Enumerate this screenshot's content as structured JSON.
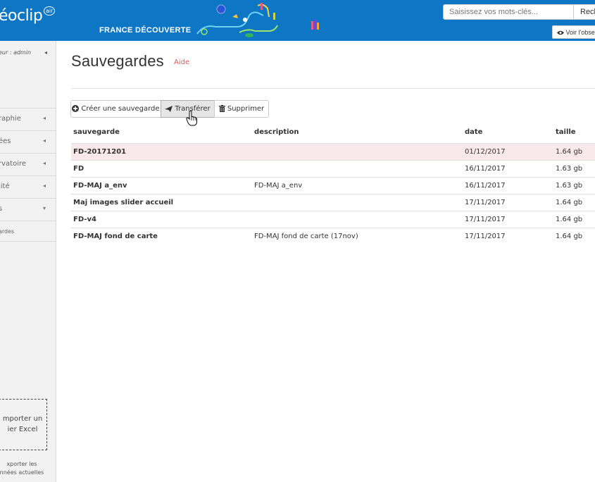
{
  "header": {
    "logo": "éoclip",
    "logo_sup": "air",
    "subtitle": "FRANCE DÉCOUVERTE",
    "search_placeholder": "Saisissez vos mots-clés...",
    "search_button": "Rech",
    "observer_button": "Voir l'obse"
  },
  "sidebar": {
    "user": "eur : admin",
    "items": [
      {
        "label": "raphie",
        "arrow": "◂"
      },
      {
        "label": "ées",
        "arrow": "◂"
      },
      {
        "label": "rvatoire",
        "arrow": "◂"
      },
      {
        "label": "lité",
        "arrow": "◂"
      },
      {
        "label": "s",
        "arrow": "▾"
      }
    ],
    "sub_item": "ardes",
    "import_label": "mporter un\nier Excel",
    "export_label": "xporter les\nnnées actuelles"
  },
  "main": {
    "title": "Sauvegardes",
    "help": "Aide",
    "buttons": {
      "create": "Créer une sauvegarde",
      "transfer": "Transférer",
      "delete": "Supprimer"
    },
    "columns": [
      "sauvegarde",
      "description",
      "date",
      "taille"
    ],
    "rows": [
      {
        "name": "FD-20171201",
        "description": "",
        "date": "01/12/2017",
        "size": "1.64 gb",
        "selected": true
      },
      {
        "name": "FD",
        "description": "",
        "date": "16/11/2017",
        "size": "1.63 gb",
        "selected": false
      },
      {
        "name": "FD-MAJ a_env",
        "description": "FD-MAJ a_env",
        "date": "16/11/2017",
        "size": "1.63 gb",
        "selected": false
      },
      {
        "name": "Maj images slider accueil",
        "description": "",
        "date": "17/11/2017",
        "size": "1.64 gb",
        "selected": false
      },
      {
        "name": "FD-v4",
        "description": "",
        "date": "17/11/2017",
        "size": "1.64 gb",
        "selected": false
      },
      {
        "name": "FD-MAJ fond de carte",
        "description": "FD-MAJ fond de carte (17nov)",
        "date": "17/11/2017",
        "size": "1.64 gb",
        "selected": false
      }
    ]
  },
  "colors": {
    "header_bg": "#0d76c5",
    "selected_row": "#f9e9ed",
    "help_link": "#e15a5a"
  }
}
